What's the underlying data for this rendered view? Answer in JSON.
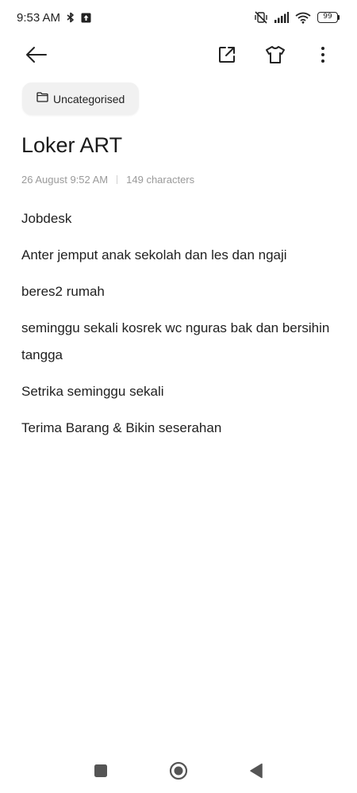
{
  "status_bar": {
    "time": "9:53 AM",
    "battery": "99",
    "icons": [
      "bluetooth-icon",
      "upload-notification-icon",
      "mute-vibrate-icon",
      "signal-icon",
      "wifi-icon",
      "battery-icon"
    ]
  },
  "toolbar": {
    "icons": [
      "back-arrow-icon",
      "open-external-icon",
      "theme-shirt-icon",
      "more-vert-icon"
    ]
  },
  "note": {
    "category": "Uncategorised",
    "title": "Loker ART",
    "date": "26 August 9:52 AM",
    "char_count": "149 characters",
    "lines": [
      "Jobdesk",
      "Anter jemput anak sekolah dan les dan ngaji",
      "beres2 rumah",
      "seminggu sekali kosrek wc nguras bak dan bersihin tangga",
      "Setrika seminggu sekali",
      "Terima Barang & Bikin seserahan"
    ]
  },
  "nav_bar": {
    "icons": [
      "recents-icon",
      "home-icon",
      "back-icon"
    ]
  },
  "colors": {
    "background": "#ffffff",
    "text": "#1a1a1a",
    "meta_text": "#9a9a9a",
    "chip_bg": "#f1f1f1",
    "nav_icon": "#555555"
  }
}
